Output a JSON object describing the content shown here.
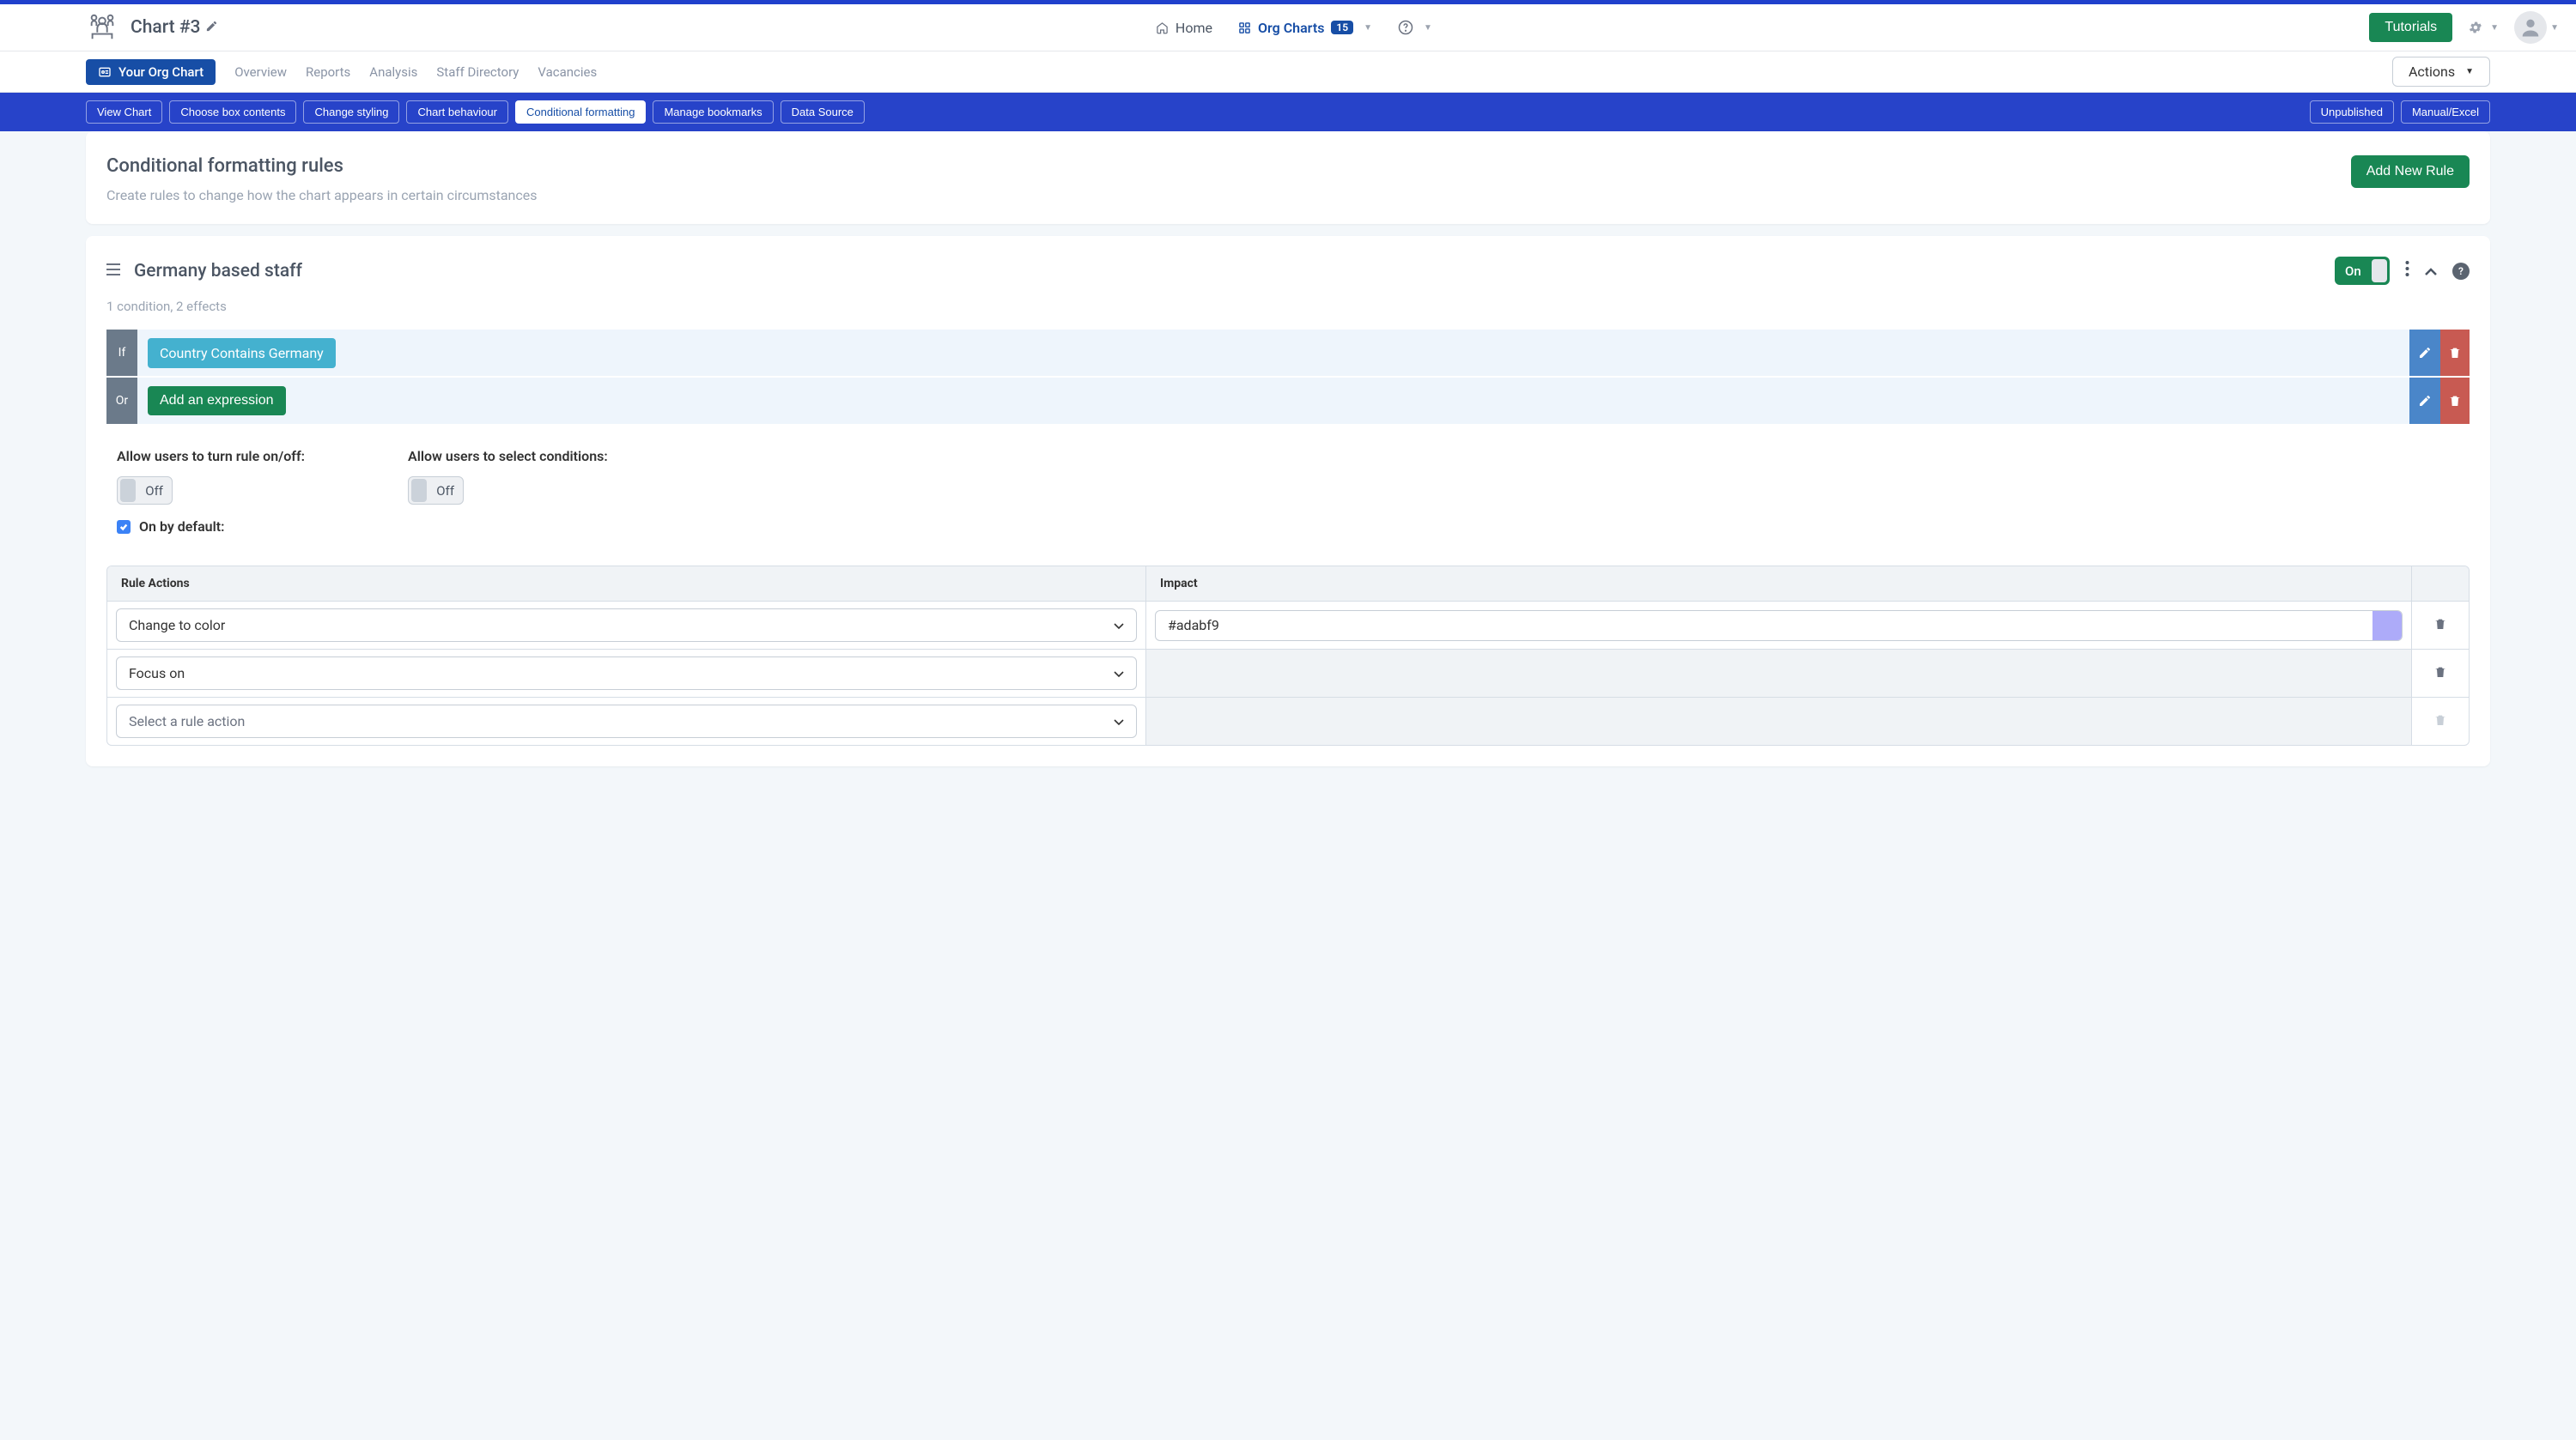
{
  "header": {
    "title": "Chart #3",
    "nav": {
      "home": "Home",
      "orgcharts": "Org Charts",
      "badge": "15"
    },
    "tutorials": "Tutorials"
  },
  "subnav": {
    "items": [
      "Your Org Chart",
      "Overview",
      "Reports",
      "Analysis",
      "Staff Directory",
      "Vacancies"
    ],
    "actions": "Actions"
  },
  "toolbar": {
    "left": [
      "View Chart",
      "Choose box contents",
      "Change styling",
      "Chart behaviour",
      "Conditional formatting",
      "Manage bookmarks",
      "Data Source"
    ],
    "right": [
      "Unpublished",
      "Manual/Excel"
    ]
  },
  "panel": {
    "title": "Conditional formatting rules",
    "subtitle": "Create rules to change how the chart appears in certain circumstances",
    "add_rule": "Add New Rule"
  },
  "rule": {
    "title": "Germany based staff",
    "meta": "1 condition, 2 effects",
    "toggle": "On",
    "conditions": [
      {
        "tag": "If",
        "text": "Country Contains Germany",
        "chip": true
      },
      {
        "tag": "Or",
        "text": "Add an expression",
        "chip": false
      }
    ],
    "opts": {
      "allow_toggle": "Allow users to turn rule on/off:",
      "allow_select": "Allow users to select conditions:",
      "off": "Off",
      "on_default": "On by default:"
    },
    "table": {
      "head_action": "Rule Actions",
      "head_impact": "Impact",
      "rows": [
        {
          "action": "Change to color",
          "impact": "#adabf9",
          "impact_type": "color",
          "deletable": true
        },
        {
          "action": "Focus on",
          "impact": "",
          "impact_type": "none",
          "deletable": true
        },
        {
          "action": "Select a rule action",
          "impact": "",
          "impact_type": "none",
          "deletable": false,
          "placeholder": true
        }
      ]
    }
  }
}
